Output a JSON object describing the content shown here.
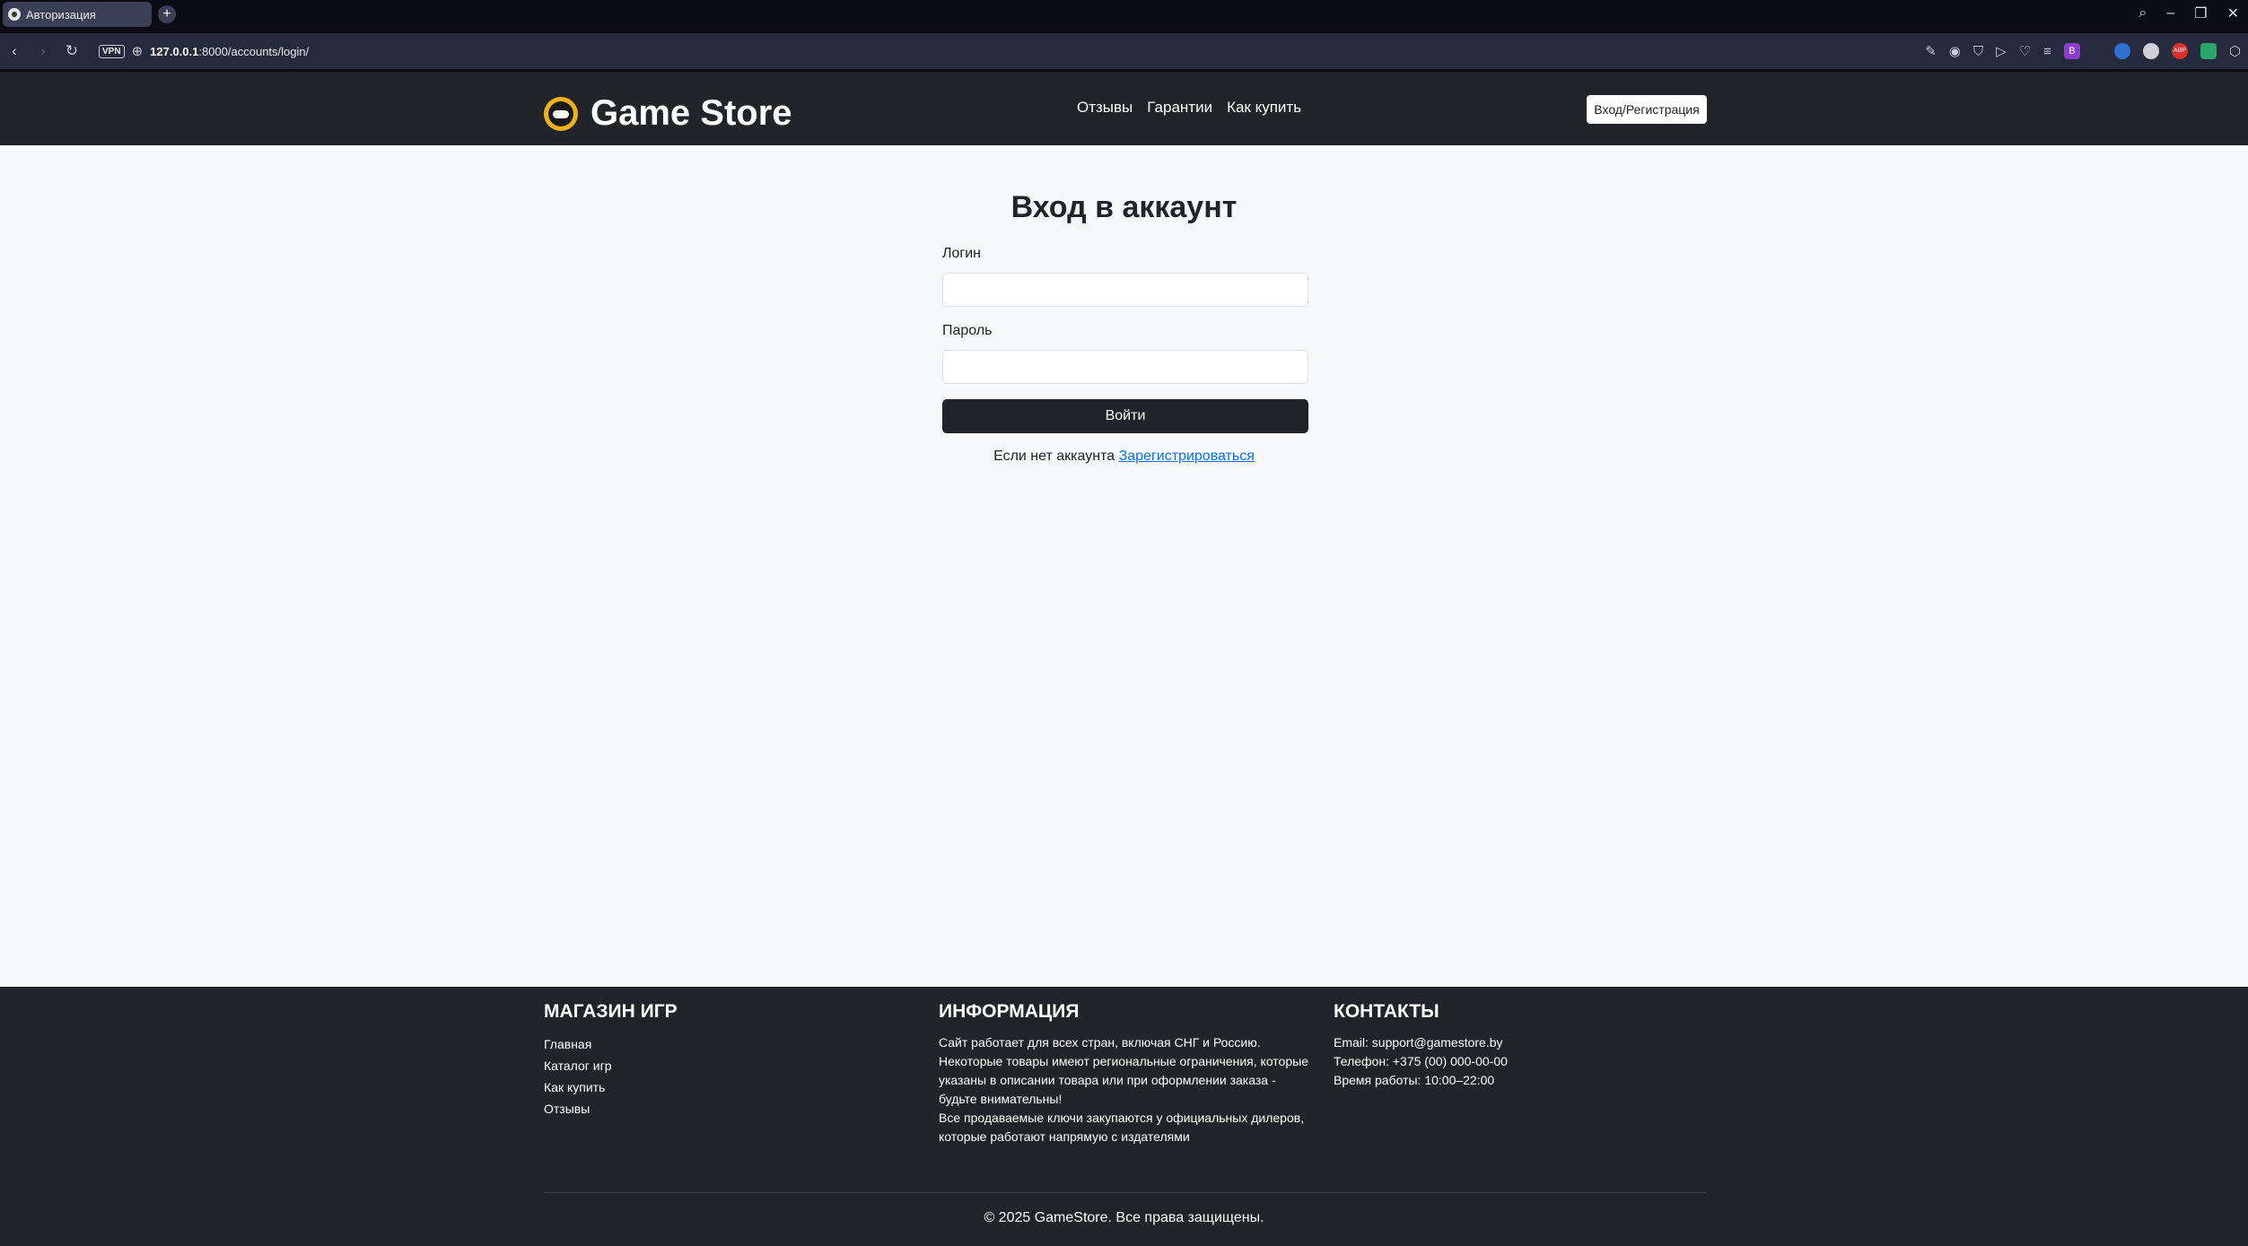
{
  "browser": {
    "tab_title": "Авторизация",
    "new_tab_symbol": "+",
    "url_host": "127.0.0.1",
    "url_rest": ":8000/accounts/login/",
    "vpn_label": "VPN",
    "extension_letter": "B",
    "extension_abp": "ABP"
  },
  "header": {
    "brand": "Game Store",
    "nav": [
      "Отзывы",
      "Гарантии",
      "Как купить"
    ],
    "login_button": "Вход/Регистрация"
  },
  "login": {
    "title": "Вход в аккаунт",
    "username_label": "Логин",
    "password_label": "Пароль",
    "username_value": "",
    "password_value": "",
    "submit": "Войти",
    "no_account_text": "Если нет аккаунта",
    "register_link": "Зарегистрироваться"
  },
  "footer": {
    "store": {
      "heading": "МАГАЗИН ИГР",
      "links": [
        "Главная",
        "Каталог игр",
        "Как купить",
        "Отзывы"
      ]
    },
    "info": {
      "heading": "ИНФОРМАЦИЯ",
      "lines": [
        "Сайт работает для всех стран, включая СНГ и Россию.",
        "Некоторые товары имеют региональные ограничения, которые",
        "указаны в описании товара или при оформлении заказа -",
        "будьте внимательны!",
        "Все продаваемые ключи закупаются у официальных дилеров,",
        "которые работают напрямую с издателями"
      ]
    },
    "contacts": {
      "heading": "КОНТАКТЫ",
      "email": "Email: support@gamestore.by",
      "phone": "Телефон: +375 (00) 000-00-00",
      "hours": "Время работы: 10:00–22:00"
    },
    "copyright": "© 2025 GameStore. Все права защищены."
  }
}
